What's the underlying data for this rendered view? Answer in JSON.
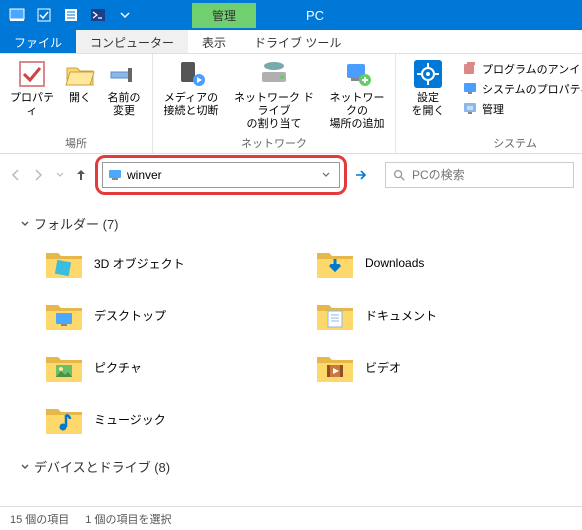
{
  "titlebar": {
    "manage_tab": "管理",
    "title": "PC"
  },
  "tabs": {
    "file": "ファイル",
    "computer": "コンピューター",
    "view": "表示",
    "drive_tools": "ドライブ ツール"
  },
  "ribbon": {
    "properties": "プロパティ",
    "open": "開く",
    "rename": "名前の\n変更",
    "group_location": "場所",
    "media": "メディアの\n接続と切断",
    "map_drive": "ネットワーク ドライブ\nの割り当て",
    "add_location": "ネットワークの\n場所の追加",
    "group_network": "ネットワーク",
    "open_settings": "設定\nを開く",
    "uninstall": "プログラムのアンインスト…",
    "sys_prop": "システムのプロパティ",
    "manage": "管理",
    "group_system": "システム"
  },
  "address": {
    "value": "winver"
  },
  "search": {
    "placeholder": "PCの検索"
  },
  "folders": {
    "header": "フォルダー (7)",
    "items": [
      {
        "name": "3D オブジェクト"
      },
      {
        "name": "Downloads"
      },
      {
        "name": "デスクトップ"
      },
      {
        "name": "ドキュメント"
      },
      {
        "name": "ピクチャ"
      },
      {
        "name": "ビデオ"
      },
      {
        "name": "ミュージック"
      }
    ]
  },
  "devices": {
    "header": "デバイスとドライブ (8)"
  },
  "status": {
    "count": "15 個の項目",
    "selected": "1 個の項目を選択"
  },
  "colors": {
    "accent": "#0078d7",
    "highlight": "#e23b3b",
    "folder": "#ffd86b",
    "folder_dark": "#e6b84a"
  }
}
